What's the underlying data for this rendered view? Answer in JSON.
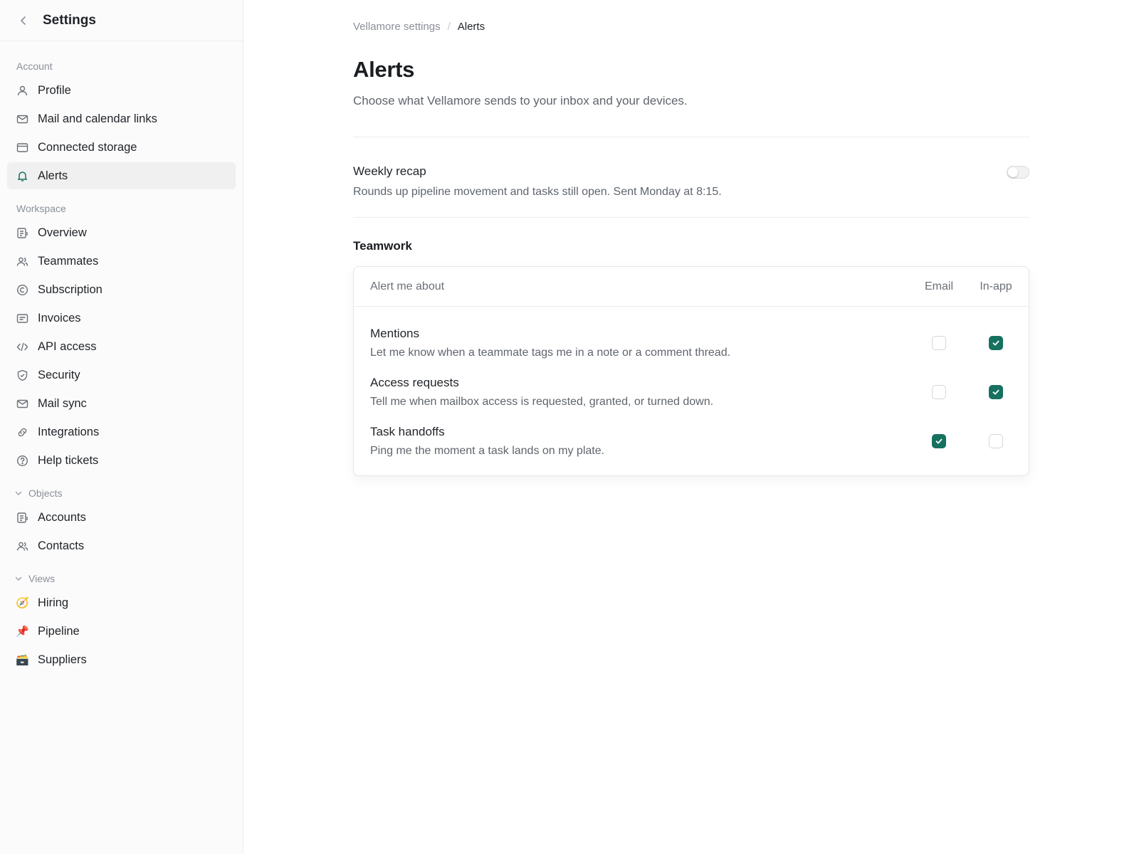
{
  "colors": {
    "accent": "#17715f",
    "sidebar_bg": "#fbfbfb"
  },
  "sidebar": {
    "title": "Settings",
    "sections": {
      "account": {
        "label": "Account",
        "items": [
          {
            "label": "Profile",
            "icon": "user-icon"
          },
          {
            "label": "Mail and calendar links",
            "icon": "mail-icon"
          },
          {
            "label": "Connected storage",
            "icon": "storage-icon"
          },
          {
            "label": "Alerts",
            "icon": "bell-icon",
            "active": true
          }
        ]
      },
      "workspace": {
        "label": "Workspace",
        "items": [
          {
            "label": "Overview",
            "icon": "document-icon"
          },
          {
            "label": "Teammates",
            "icon": "users-icon"
          },
          {
            "label": "Subscription",
            "icon": "copyright-icon"
          },
          {
            "label": "Invoices",
            "icon": "invoice-icon"
          },
          {
            "label": "API access",
            "icon": "code-icon"
          },
          {
            "label": "Security",
            "icon": "shield-icon"
          },
          {
            "label": "Mail sync",
            "icon": "mail-icon"
          },
          {
            "label": "Integrations",
            "icon": "link-icon"
          },
          {
            "label": "Help tickets",
            "icon": "help-icon"
          }
        ]
      },
      "objects": {
        "label": "Objects",
        "items": [
          {
            "label": "Accounts",
            "icon": "document-icon"
          },
          {
            "label": "Contacts",
            "icon": "users-icon"
          }
        ]
      },
      "views": {
        "label": "Views",
        "items": [
          {
            "label": "Hiring",
            "icon": "compass-emoji",
            "emoji": "🧭"
          },
          {
            "label": "Pipeline",
            "icon": "pushpin-emoji",
            "emoji": "📌"
          },
          {
            "label": "Suppliers",
            "icon": "box-emoji",
            "emoji": "🗃️"
          }
        ]
      }
    }
  },
  "main": {
    "breadcrumb": {
      "parent": "Vellamore settings",
      "separator": "/",
      "current": "Alerts"
    },
    "title": "Alerts",
    "subtitle": "Choose what Vellamore sends to your inbox and your devices.",
    "weekly_recap": {
      "title": "Weekly recap",
      "description": "Rounds up pipeline movement and tasks still open. Sent Monday at 8:15.",
      "enabled": false
    },
    "teamwork": {
      "heading": "Teamwork",
      "columns": {
        "about": "Alert me about",
        "email": "Email",
        "inapp": "In-app"
      },
      "rows": [
        {
          "title": "Mentions",
          "description": "Let me know when a teammate tags me in a note or a comment thread.",
          "email": false,
          "inapp": true
        },
        {
          "title": "Access requests",
          "description": "Tell me when mailbox access is requested, granted, or turned down.",
          "email": false,
          "inapp": true
        },
        {
          "title": "Task handoffs",
          "description": "Ping me the moment a task lands on my plate.",
          "email": true,
          "inapp": false
        }
      ]
    }
  }
}
